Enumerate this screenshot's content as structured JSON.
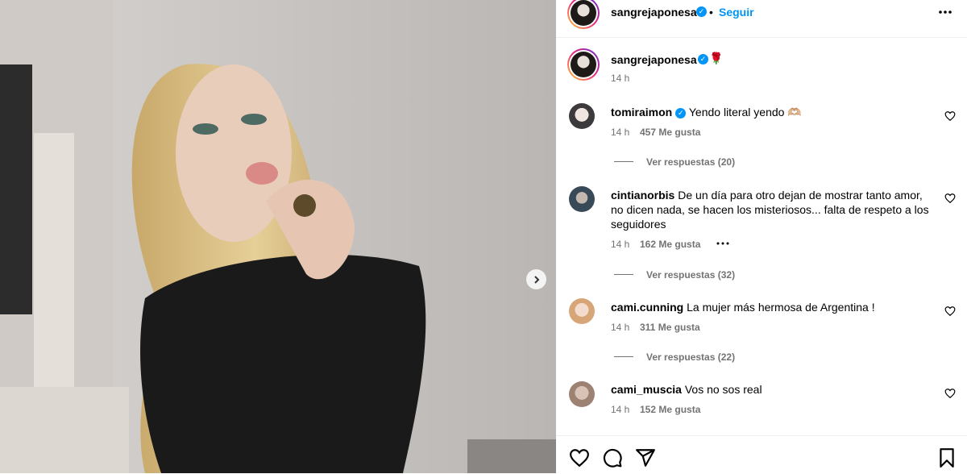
{
  "header": {
    "username": "sangrejaponesa",
    "separator": "•",
    "follow_label": "Seguir"
  },
  "caption": {
    "username": "sangrejaponesa",
    "emoji": "🌹",
    "time": "14 h"
  },
  "comments": [
    {
      "username": "tomiraimon",
      "verified": true,
      "text": "Yendo literal yendo 🫶🏼",
      "time": "14 h",
      "likes": "457 Me gusta",
      "replies": "Ver respuestas (20)"
    },
    {
      "username": "cintianorbis",
      "verified": false,
      "text": "De un día para otro dejan de mostrar tanto amor, no dicen nada, se hacen los misteriosos... falta de respeto a los seguidores",
      "time": "14 h",
      "likes": "162 Me gusta",
      "replies": "Ver respuestas (32)"
    },
    {
      "username": "cami.cunning",
      "verified": false,
      "text": "La mujer más hermosa de Argentina !",
      "time": "14 h",
      "likes": "311 Me gusta",
      "replies": "Ver respuestas (22)"
    },
    {
      "username": "cami_muscia",
      "verified": false,
      "text": "Vos no sos real",
      "time": "14 h",
      "likes": "152 Me gusta"
    }
  ],
  "colors": {
    "accent": "#0095f6",
    "muted": "#737373"
  },
  "icons": [
    "more-options-icon",
    "heart-icon",
    "comment-icon",
    "share-icon",
    "bookmark-icon",
    "chevron-right-icon",
    "verified-icon",
    "rose-emoji"
  ]
}
